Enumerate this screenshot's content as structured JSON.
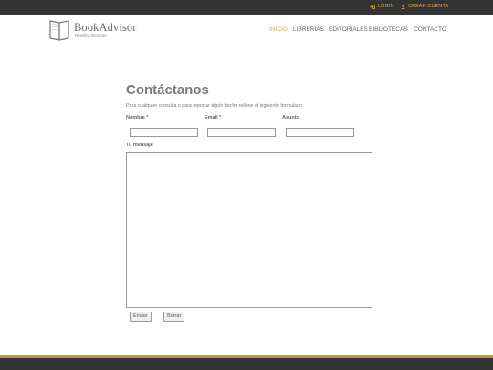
{
  "topbar": {
    "login_label": "LOGIN",
    "login_icon": "sign-in-icon",
    "register_label": "CREAR CUENTA",
    "register_icon": "user-icon"
  },
  "brand": {
    "name": "BookAdvisor",
    "tagline": "Reseñas literarias"
  },
  "nav": {
    "items": [
      {
        "label": "INICIO",
        "active": true
      },
      {
        "label": "LIBRERÍAS",
        "active": false
      },
      {
        "label": "EDITORIALES",
        "active": false
      },
      {
        "label": "BIBLIOTECAS",
        "active": false
      },
      {
        "label": "CONTACTO",
        "active": false
      }
    ]
  },
  "main": {
    "title": "Contáctanos",
    "intro": "Para cualquier consulta o para reportar algún hecho rellene el siguiente formulario:"
  },
  "form": {
    "name_label": "Nombre *",
    "email_label": "Email *",
    "subject_label": "Asunto",
    "message_label": "Tu mensaje",
    "name_value": "",
    "email_value": "",
    "subject_value": "",
    "message_value": "",
    "submit_label": "Enviar",
    "reset_label": "Borrar"
  },
  "colors": {
    "accent": "#e0a84a",
    "topbar_bg": "#333333",
    "footer_line": "#c9913d",
    "footer_bg": "#333333"
  }
}
